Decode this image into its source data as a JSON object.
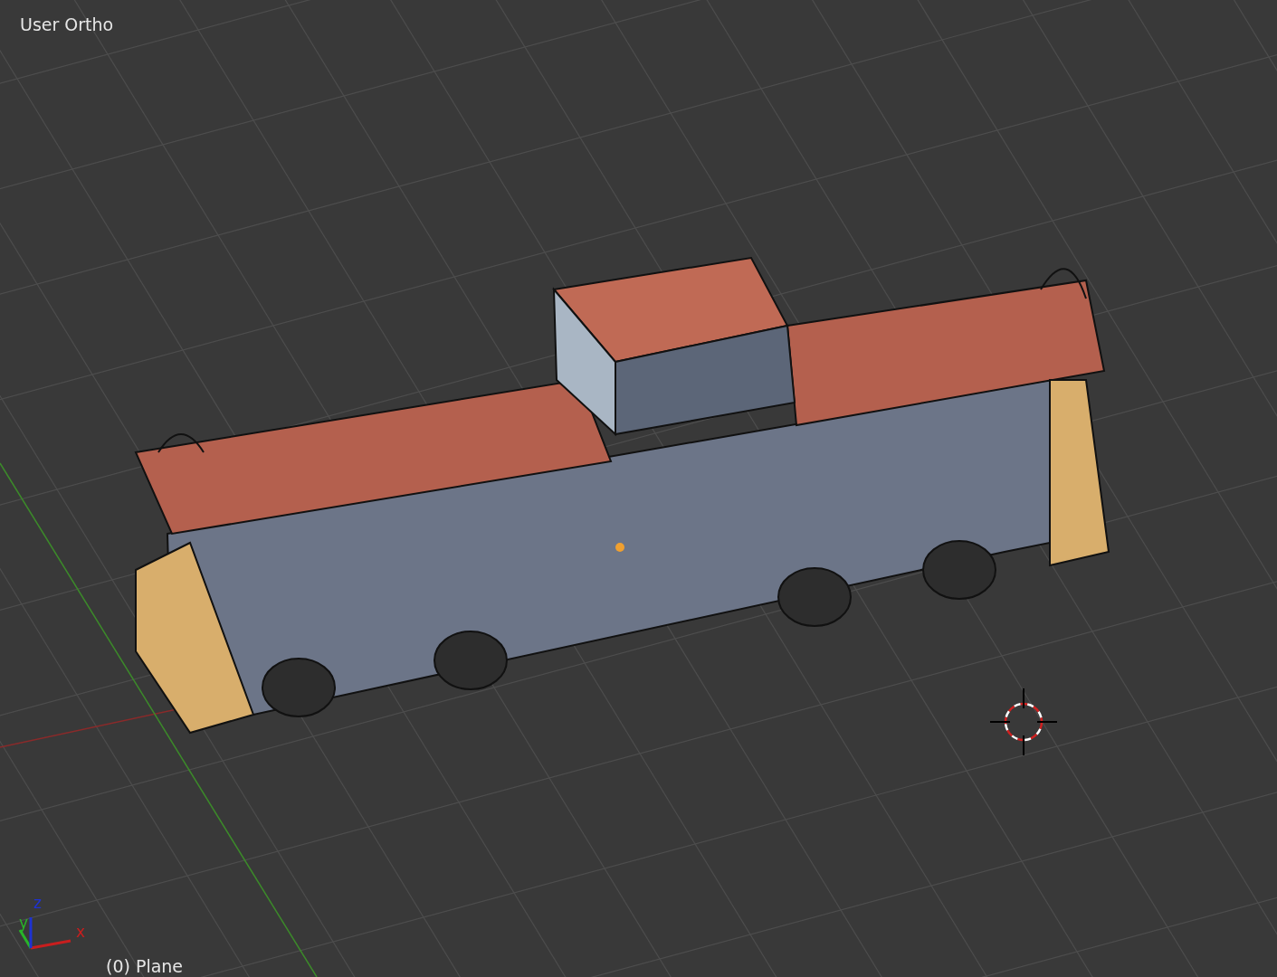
{
  "viewport": {
    "view_name": "User Ortho",
    "object_label": "(0) Plane",
    "axes": [
      {
        "label": "x",
        "color": "#c81e1e"
      },
      {
        "label": "y",
        "color": "#28b428"
      },
      {
        "label": "z",
        "color": "#1e32d2"
      }
    ]
  }
}
